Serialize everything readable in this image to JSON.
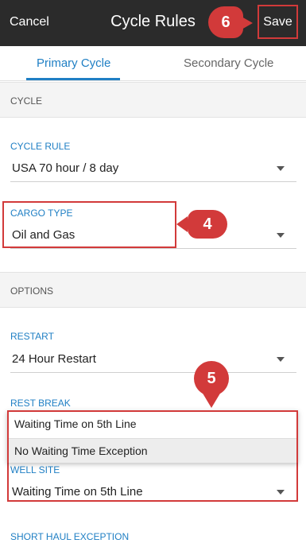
{
  "header": {
    "cancel_label": "Cancel",
    "title": "Cycle Rules",
    "save_label": "Save"
  },
  "tabs": [
    {
      "label": "Primary Cycle",
      "active": true
    },
    {
      "label": "Secondary Cycle",
      "active": false
    }
  ],
  "sections": {
    "cycle": "CYCLE",
    "options": "OPTIONS"
  },
  "fields": {
    "cycle_rule": {
      "label": "CYCLE RULE",
      "value": "USA 70 hour / 8 day"
    },
    "cargo_type": {
      "label": "CARGO TYPE",
      "value": "Oil and Gas"
    },
    "restart": {
      "label": "RESTART",
      "value": "24 Hour Restart"
    },
    "rest_break": {
      "label": "REST BREAK"
    },
    "well_site": {
      "label": "WELL SITE",
      "value": "Waiting Time on 5th Line"
    },
    "short_haul": {
      "label": "SHORT HAUL EXCEPTION"
    }
  },
  "dropdown_options": [
    "Waiting Time on 5th Line",
    "No Waiting Time Exception"
  ],
  "callouts": {
    "save": "6",
    "cargo": "4",
    "dropdown": "5"
  },
  "colors": {
    "accent": "#1f7fc4",
    "callout": "#d23a3a",
    "header_bg": "#2b2b2b"
  }
}
